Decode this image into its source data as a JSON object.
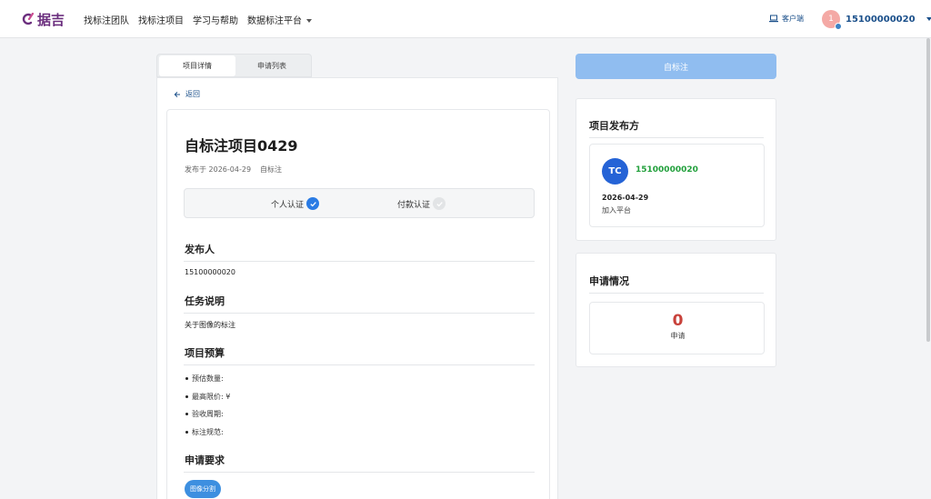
{
  "header": {
    "logo_text": "据吉",
    "nav": [
      "找标注团队",
      "找标注项目",
      "学习与帮助",
      "数据标注平台"
    ],
    "client_label": "客户端",
    "user_avatar_text": "1",
    "user_name": "15100000020"
  },
  "tabs": [
    "项目详情",
    "申请列表"
  ],
  "back_label": "返回",
  "project": {
    "title": "自标注项目0429",
    "published_date": "发布于 2026-04-29",
    "type": "自标注",
    "verifications": [
      {
        "label": "个人认证",
        "verified": true
      },
      {
        "label": "付款认证",
        "verified": false
      }
    ],
    "publisher_heading": "发布人",
    "publisher_value": "15100000020",
    "task_heading": "任务说明",
    "task_value": "关于图像的标注",
    "budget_heading": "项目预算",
    "budget_items": [
      "预估数量:",
      "最高限价: ¥",
      "验收周期:",
      "标注规范:"
    ],
    "requirements_heading": "申请要求",
    "requirement_tag": "图像分割"
  },
  "self_label_button": "自标注",
  "publisher_card": {
    "title": "项目发布方",
    "avatar_text": "TC",
    "name": "15100000020",
    "join_date": "2026-04-29",
    "join_label": "加入平台"
  },
  "application_card": {
    "title": "申请情况",
    "count": "0",
    "count_label": "申请"
  },
  "colors": {
    "accent": "#2a7be4",
    "button": "#90bdf0",
    "publisher_name": "#22a03c",
    "count": "#c8423b",
    "logo": "#6b2f7e"
  }
}
